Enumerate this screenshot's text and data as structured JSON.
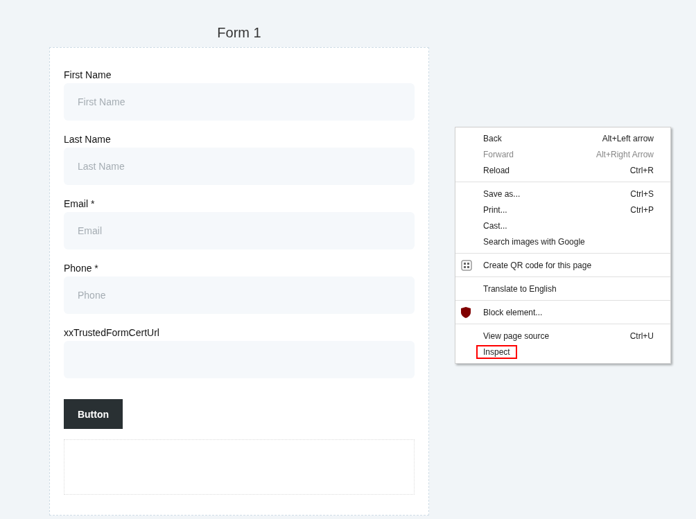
{
  "form": {
    "title": "Form 1",
    "fields": [
      {
        "label": "First Name",
        "placeholder": "First Name"
      },
      {
        "label": "Last Name",
        "placeholder": "Last Name"
      },
      {
        "label": "Email *",
        "placeholder": "Email"
      },
      {
        "label": "Phone *",
        "placeholder": "Phone"
      },
      {
        "label": "xxTrustedFormCertUrl"
      }
    ],
    "button": "Button"
  },
  "context_menu": {
    "groups": [
      [
        {
          "label": "Back",
          "shortcut": "Alt+Left arrow",
          "disabled": false,
          "highlighted": false
        },
        {
          "label": "Forward",
          "shortcut": "Alt+Right Arrow",
          "disabled": true,
          "highlighted": false
        },
        {
          "label": "Reload",
          "shortcut": "Ctrl+R",
          "disabled": false,
          "highlighted": false
        }
      ],
      [
        {
          "label": "Save as...",
          "shortcut": "Ctrl+S",
          "disabled": false,
          "highlighted": false
        },
        {
          "label": "Print...",
          "shortcut": "Ctrl+P",
          "disabled": false,
          "highlighted": false
        },
        {
          "label": "Cast...",
          "disabled": false,
          "highlighted": false
        },
        {
          "label": "Search images with Google",
          "disabled": false,
          "highlighted": false
        }
      ],
      [
        {
          "label": "Create QR code for this page",
          "kind": "qr",
          "disabled": false,
          "highlighted": false
        }
      ],
      [
        {
          "label": "Translate to English",
          "disabled": false,
          "highlighted": false
        }
      ],
      [
        {
          "label": "Block element...",
          "kind": "shield",
          "disabled": false,
          "highlighted": false
        }
      ],
      [
        {
          "label": "View page source",
          "shortcut": "Ctrl+U",
          "disabled": false,
          "highlighted": false
        },
        {
          "label": "Inspect",
          "disabled": false,
          "highlighted": true
        }
      ]
    ]
  }
}
